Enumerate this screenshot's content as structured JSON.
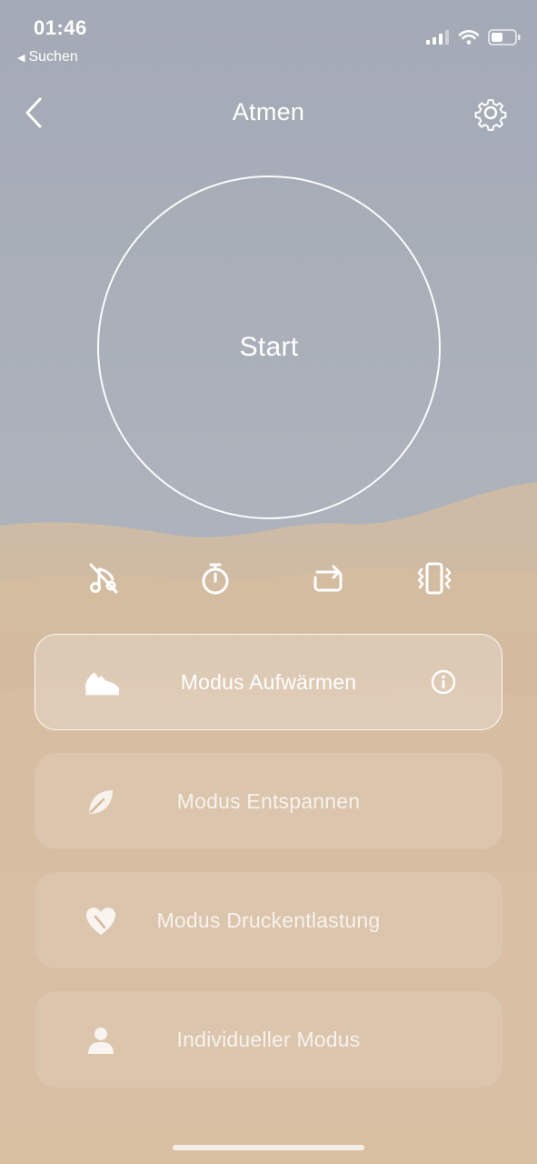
{
  "status_bar": {
    "time": "01:46",
    "back_app": "Suchen"
  },
  "nav": {
    "title": "Atmen"
  },
  "start": {
    "label": "Start"
  },
  "controls": [
    {
      "icon": "music-off-icon"
    },
    {
      "icon": "timer-icon"
    },
    {
      "icon": "repeat-icon"
    },
    {
      "icon": "vibrate-icon"
    }
  ],
  "modes": [
    {
      "label": "Modus Aufwärmen",
      "icon": "sneaker-icon",
      "active": true
    },
    {
      "label": "Modus Entspannen",
      "icon": "leaf-icon",
      "active": false
    },
    {
      "label": "Modus Druckentlastung",
      "icon": "heart-pulse-icon",
      "active": false
    },
    {
      "label": "Individueller Modus",
      "icon": "person-icon",
      "active": false
    }
  ],
  "colors": {
    "sky": "#a3a9b4",
    "sand": "#d1b79c",
    "accent": "#ffffff"
  }
}
